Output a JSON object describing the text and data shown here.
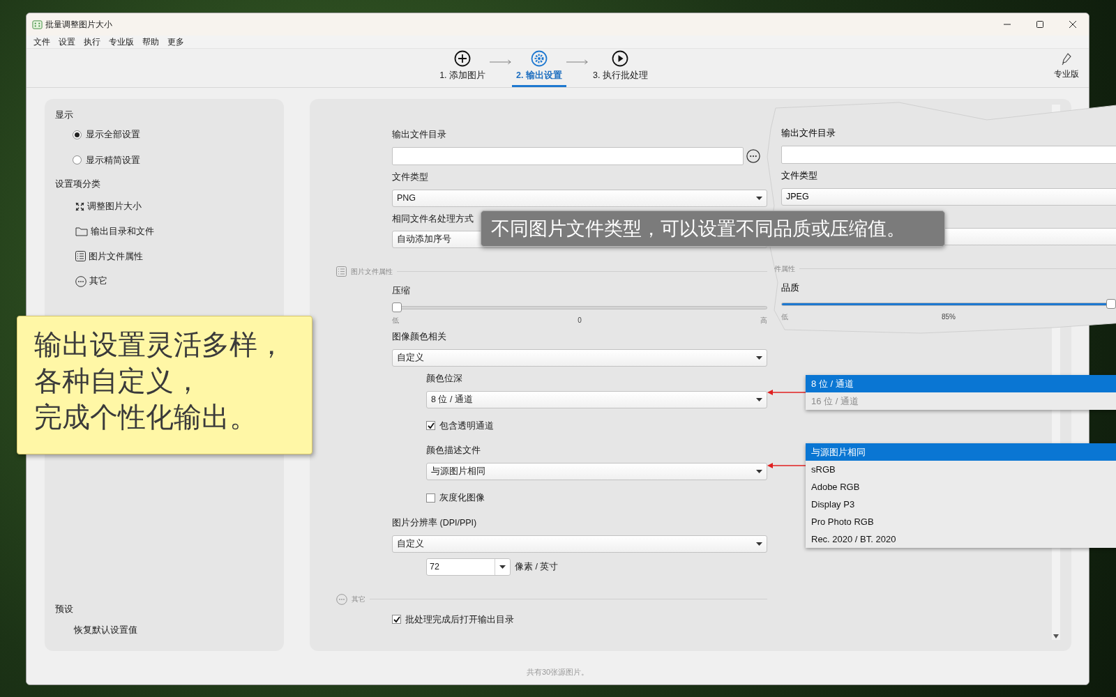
{
  "window": {
    "title": "批量调整图片大小"
  },
  "menu": [
    "文件",
    "设置",
    "执行",
    "专业版",
    "帮助",
    "更多"
  ],
  "steps": [
    {
      "label": "1. 添加图片",
      "kind": "add",
      "selected": false
    },
    {
      "label": "2. 输出设置",
      "kind": "settings",
      "selected": true
    },
    {
      "label": "3. 执行批处理",
      "kind": "run",
      "selected": false
    }
  ],
  "pro_button": {
    "label": "专业版"
  },
  "sidebar": {
    "display_heading": "显示",
    "display_options": [
      {
        "label": "显示全部设置",
        "selected": true
      },
      {
        "label": "显示精简设置",
        "selected": false
      }
    ],
    "categories_heading": "设置项分类",
    "categories": [
      {
        "label": "调整图片大小",
        "kind": "resize"
      },
      {
        "label": "输出目录和文件",
        "kind": "folder"
      },
      {
        "label": "图片文件属性",
        "kind": "list"
      },
      {
        "label": "其它",
        "kind": "more"
      }
    ],
    "preset_heading": "预设",
    "preset_items": [
      "恢复默认设置值"
    ]
  },
  "form": {
    "rows": [
      {
        "kind": "label",
        "text": "输出文件目录"
      },
      {
        "kind": "path-input"
      },
      {
        "kind": "label",
        "text": "文件类型"
      },
      {
        "kind": "select",
        "value": "PNG"
      },
      {
        "kind": "label",
        "text": "相同文件名处理方式"
      },
      {
        "kind": "select",
        "value": "自动添加序号"
      },
      {
        "kind": "section",
        "text": "图片文件属性",
        "icon": {
          "kind": "list"
        }
      },
      {
        "kind": "label",
        "text": "压缩"
      },
      {
        "kind": "slider",
        "level": 0,
        "low": "低",
        "reading": "0",
        "high": "高"
      },
      {
        "kind": "label",
        "text": "图像颜色相关"
      },
      {
        "kind": "select",
        "value": "自定义",
        "children": [
          {
            "kind": "label",
            "text": "颜色位深"
          },
          {
            "kind": "select",
            "value": "8 位 / 通道"
          },
          {
            "kind": "checkbox",
            "label": "包含透明通道",
            "checked": true
          },
          {
            "kind": "label",
            "text": "颜色描述文件"
          },
          {
            "kind": "select",
            "value": "与源图片相同"
          },
          {
            "kind": "checkbox",
            "label": "灰度化图像",
            "checked": false
          }
        ]
      },
      {
        "kind": "label",
        "text": "图片分辨率 (DPI/PPI)"
      },
      {
        "kind": "select",
        "value": "自定义",
        "children": [
          {
            "kind": "number-combo",
            "value": "72",
            "unit": "像素 / 英寸"
          }
        ]
      },
      {
        "kind": "section",
        "text": "其它",
        "icon": {
          "kind": "more"
        }
      },
      {
        "kind": "checkbox",
        "label": "批处理完成后打开输出目录",
        "checked": true
      }
    ]
  },
  "status_bar": "共有30张源图片。",
  "callout": {
    "lines": [
      "输出设置灵活多样，",
      "各种自定义，",
      "完成个性化输出。"
    ]
  },
  "tooltip": "不同图片文件类型，可以设置不同品质或压缩值。",
  "overlay_panel": {
    "rows": [
      {
        "kind": "label",
        "text": "输出文件目录"
      },
      {
        "kind": "path-input"
      },
      {
        "kind": "label",
        "text": "文件类型"
      },
      {
        "kind": "select",
        "value": "JPEG"
      },
      {
        "kind": "select"
      },
      {
        "kind": "section",
        "text": "件属性"
      },
      {
        "kind": "label",
        "text": "品质"
      },
      {
        "kind": "slider",
        "level": 1,
        "low": "低",
        "reading": "85%"
      }
    ]
  },
  "dropdowns": [
    {
      "options": [
        {
          "label": "8 位 / 通道",
          "selected": true,
          "disabled": false
        },
        {
          "label": "16 位 / 通道",
          "selected": false,
          "disabled": true
        }
      ]
    },
    {
      "options": [
        {
          "label": "与源图片相同",
          "selected": true,
          "disabled": false
        },
        {
          "label": "sRGB",
          "selected": false,
          "disabled": false
        },
        {
          "label": "Adobe RGB",
          "selected": false,
          "disabled": false
        },
        {
          "label": "Display P3",
          "selected": false,
          "disabled": false
        },
        {
          "label": "Pro Photo RGB",
          "selected": false,
          "disabled": false
        },
        {
          "label": "Rec. 2020 / BT. 2020",
          "selected": false,
          "disabled": false
        }
      ]
    }
  ]
}
